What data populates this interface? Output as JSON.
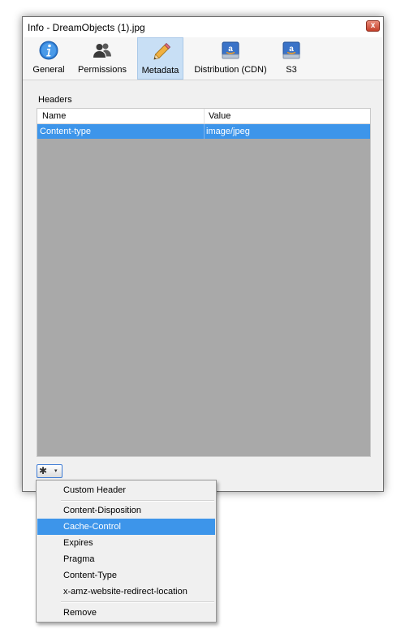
{
  "window": {
    "title": "Info - DreamObjects (1).jpg",
    "close_glyph": "x"
  },
  "tabs": [
    {
      "label": "General",
      "icon": "info-icon"
    },
    {
      "label": "Permissions",
      "icon": "users-icon"
    },
    {
      "label": "Metadata",
      "icon": "pencil-icon",
      "active": true
    },
    {
      "label": "Distribution (CDN)",
      "icon": "amazon-drive-icon"
    },
    {
      "label": "S3",
      "icon": "amazon-drive-icon"
    }
  ],
  "headers": {
    "label": "Headers",
    "columns": [
      "Name",
      "Value"
    ],
    "rows": [
      {
        "name": "Content-type",
        "value": "image/jpeg",
        "selected": true
      }
    ]
  },
  "action_button": {
    "icon": "gear-icon",
    "caret": "▾",
    "gear_glyph": "✱"
  },
  "menu": {
    "items": [
      {
        "label": "Custom Header"
      },
      {
        "label": "Content-Disposition"
      },
      {
        "label": "Cache-Control",
        "highlighted": true
      },
      {
        "label": "Expires"
      },
      {
        "label": "Pragma"
      },
      {
        "label": "Content-Type"
      },
      {
        "label": "x-amz-website-redirect-location"
      },
      {
        "label": "Remove"
      }
    ]
  },
  "colors": {
    "selection": "#3d95ea",
    "table_background": "#a9a9a9"
  }
}
